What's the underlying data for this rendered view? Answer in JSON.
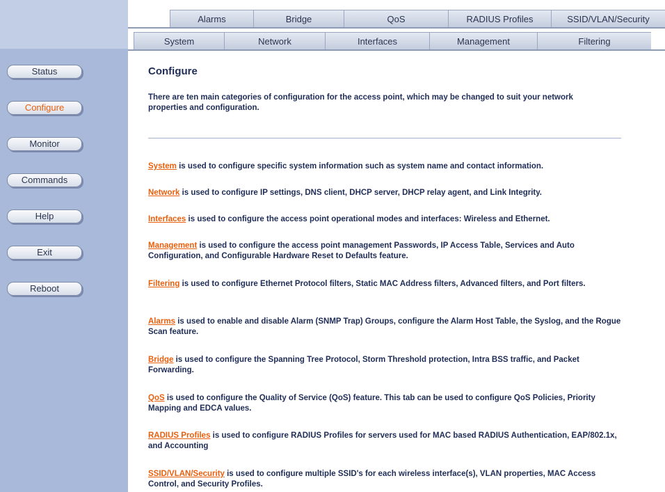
{
  "tabs": {
    "row1": [
      "Alarms",
      "Bridge",
      "QoS",
      "RADIUS Profiles",
      "SSID/VLAN/Security"
    ],
    "row2": [
      "System",
      "Network",
      "Interfaces",
      "Management",
      "Filtering"
    ]
  },
  "sidebar": {
    "items": [
      {
        "label": "Status",
        "active": false
      },
      {
        "label": "Configure",
        "active": true
      },
      {
        "label": "Monitor",
        "active": false
      },
      {
        "label": "Commands",
        "active": false
      },
      {
        "label": "Help",
        "active": false
      },
      {
        "label": "Exit",
        "active": false
      },
      {
        "label": "Reboot",
        "active": false
      }
    ]
  },
  "main": {
    "title": "Configure",
    "intro": "There are ten main categories of configuration for the access point, which may be changed to suit your network properties and configuration.",
    "items": [
      {
        "link": "System",
        "text": " is used to configure specific system information such as system name and contact information."
      },
      {
        "link": "Network",
        "text": " is used to configure IP settings, DNS client, DHCP server, DHCP relay agent, and Link Integrity."
      },
      {
        "link": "Interfaces",
        "text": " is used to configure the access point operational modes and interfaces: Wireless and Ethernet."
      },
      {
        "link": "Management",
        "text": " is used to configure the access point management Passwords, IP Access Table, Services and Auto Configuration, and Configurable Hardware Reset to Defaults feature."
      },
      {
        "link": "Filtering",
        "text": " is used to configure Ethernet Protocol filters, Static MAC Address filters, Advanced filters, and Port filters."
      },
      {
        "link": "Alarms",
        "text": " is used to enable and disable Alarm (SNMP Trap) Groups, configure the Alarm Host Table, the Syslog, and the Rogue Scan feature."
      },
      {
        "link": "Bridge",
        "text": " is used to configure the Spanning Tree Protocol, Storm Threshold protection, Intra BSS traffic, and Packet Forwarding."
      },
      {
        "link": "QoS",
        "text": " is used to configure the Quality of Service (QoS) feature. This tab can be used to configure QoS Policies, Priority Mapping and EDCA values."
      },
      {
        "link": "RADIUS Profiles",
        "text": " is used to configure RADIUS Profiles for servers used for MAC based RADIUS Authentication, EAP/802.1x, and Accounting"
      },
      {
        "link": "SSID/VLAN/Security",
        "text": " is used to configure multiple SSID's for each wireless interface(s), VLAN properties, MAC Access Control, and Security Profiles."
      }
    ]
  },
  "colors": {
    "accent": "#e8600e",
    "text": "#1f2d57",
    "sidebar": "#a9b9d9"
  }
}
